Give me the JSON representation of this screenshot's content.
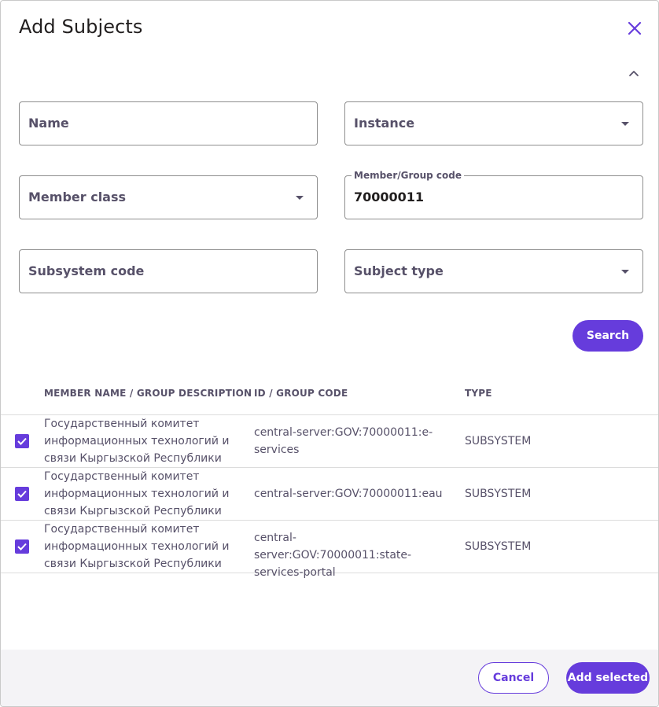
{
  "dialog": {
    "title": "Add Subjects",
    "close_icon": "close-icon",
    "collapse_icon": "chevron-up-icon"
  },
  "filters": {
    "name_label": "Name",
    "instance_label": "Instance",
    "member_class_label": "Member class",
    "member_group_code_label": "Member/Group code",
    "member_group_code_value": "70000011",
    "subsystem_code_label": "Subsystem code",
    "subject_type_label": "Subject type",
    "search_button": "Search"
  },
  "table": {
    "headers": {
      "member_name": "MEMBER NAME / GROUP DESCRIPTION",
      "id": "ID / GROUP CODE",
      "type": "TYPE"
    },
    "rows": [
      {
        "checked": true,
        "name": "Государственный комитет информационных технологий и связи Кыргызской Республики",
        "id": "central-server:GOV:70000011:e-services",
        "type": "SUBSYSTEM"
      },
      {
        "checked": true,
        "name": "Государственный комитет информационных технологий и связи Кыргызской Республики",
        "id": "central-server:GOV:70000011:eau",
        "type": "SUBSYSTEM"
      },
      {
        "checked": true,
        "name": "Государственный комитет информационных технологий и связи Кыргызской Республики",
        "id": "central-server:GOV:70000011:state-services-portal",
        "type": "SUBSYSTEM"
      }
    ]
  },
  "footer": {
    "cancel_button": "Cancel",
    "add_selected_button": "Add selected"
  },
  "colors": {
    "accent": "#663cdc",
    "text_secondary": "#575169",
    "footer_bg": "#f4f3f6"
  }
}
